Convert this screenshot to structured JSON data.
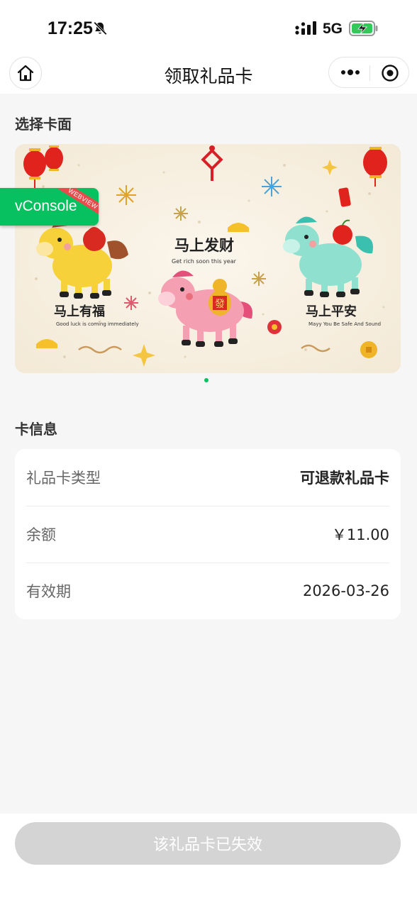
{
  "status_bar": {
    "time": "17:25",
    "network": "5G",
    "icons": [
      "bell-off-icon",
      "signal-icon",
      "battery-charging-icon"
    ]
  },
  "nav": {
    "title": "领取礼品卡",
    "icons": [
      "home-icon",
      "more-icon",
      "target-icon"
    ]
  },
  "card_face_section": {
    "title": "选择卡面",
    "image": {
      "phrases": [
        {
          "cn": "马上发财",
          "en": "Get rich soon this year"
        },
        {
          "cn": "马上有福",
          "en": "Good luck is coming immediately"
        },
        {
          "cn": "马上平安",
          "en": "Mayy You Be Safe And Sound"
        }
      ],
      "stamp_fu": "福",
      "stamp_fa": "發",
      "stamp_an": "安"
    }
  },
  "vconsole": {
    "label": "vConsole",
    "ribbon": "WEBVIEW"
  },
  "info_section": {
    "title": "卡信息",
    "rows": [
      {
        "label": "礼品卡类型",
        "value": "可退款礼品卡"
      },
      {
        "label": "余额",
        "value": "￥11.00"
      },
      {
        "label": "有效期",
        "value": "2026-03-26"
      }
    ]
  },
  "bottom": {
    "button_label": "该礼品卡已失效"
  },
  "colors": {
    "accent": "#07c160",
    "disabled_button": "#d4d4d4",
    "page_bg": "#f6f6f6",
    "card_bg": "#f8f1e4"
  }
}
